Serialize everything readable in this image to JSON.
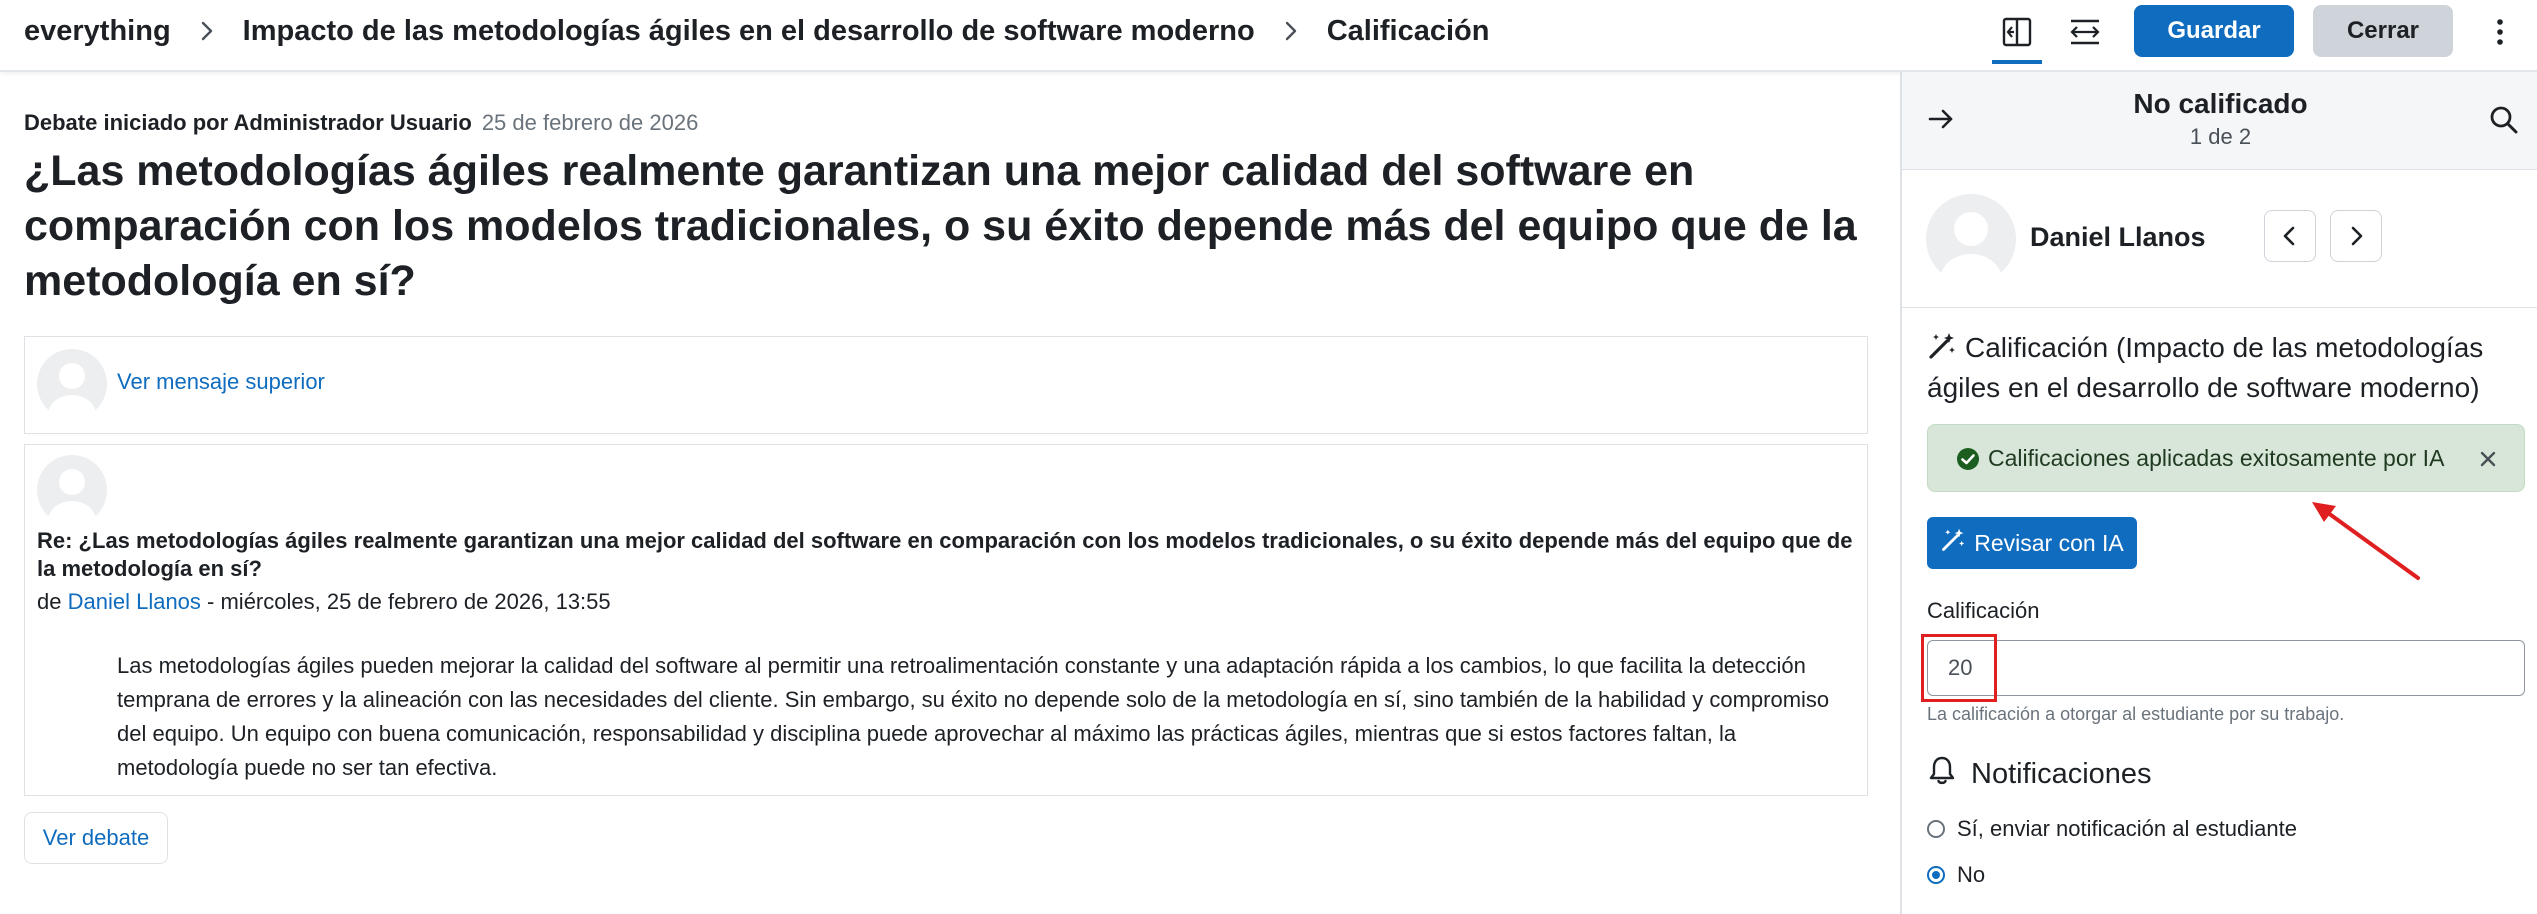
{
  "breadcrumb": {
    "items": [
      "everything",
      "Impacto de las metodologías ágiles en el desarrollo de software moderno",
      "Calificación"
    ]
  },
  "toolbar": {
    "collapse_icon": "collapse-panel-icon",
    "expand_icon": "expand-width-icon",
    "save_label": "Guardar",
    "close_label": "Cerrar",
    "more_icon": "kebab-icon"
  },
  "discussion": {
    "starter_prefix": "Debate iniciado por Administrador Usuario",
    "starter_date": "25 de febrero de 2026",
    "title": "¿Las metodologías ágiles realmente garantizan una mejor calidad del software en comparación con los modelos tradicionales, o su éxito depende más del equipo que de la metodología en sí?",
    "parent_link": "Ver mensaje superior",
    "post": {
      "subject": "Re: ¿Las metodologías ágiles realmente garantizan una mejor calidad del software en comparación con los modelos tradicionales, o su éxito depende más del equipo que de la metodología en sí?",
      "by_prefix": "de",
      "author": "Daniel Llanos",
      "date": "- miércoles, 25 de febrero de 2026, 13:55",
      "body": "Las metodologías ágiles pueden mejorar la calidad del software al permitir una retroalimentación constante y una adaptación rápida a los cambios, lo que facilita la detección temprana de errores y la alineación con las necesidades del cliente. Sin embargo, su éxito no depende solo de la metodología en sí, sino también de la habilidad y compromiso del equipo. Un equipo con buena comunicación, responsabilidad y disciplina puede aprovechar al máximo las prácticas ágiles, mientras que si estos factores faltan, la metodología puede no ser tan efectiva."
    },
    "view_button": "Ver debate"
  },
  "panel": {
    "status": "No calificado",
    "count": "1 de 2",
    "user_name": "Daniel Llanos",
    "grade_section_title": "Calificación (Impacto de las metodologías ágiles en el desarrollo de software moderno)",
    "alert_text": "Calificaciones aplicadas exitosamente por IA",
    "ai_button": "Revisar con IA",
    "grade_label": "Calificación",
    "grade_value": "20",
    "grade_help": "La calificación a otorgar al estudiante por su trabajo.",
    "notifications_title": "Notificaciones",
    "radio_yes": "Sí, enviar notificación al estudiante",
    "radio_no": "No",
    "selected_radio": "No"
  },
  "colors": {
    "primary": "#0f6cbf",
    "success_bg": "#d7e6d8",
    "success_icon": "#1b5e20",
    "annotation": "#e02020"
  }
}
